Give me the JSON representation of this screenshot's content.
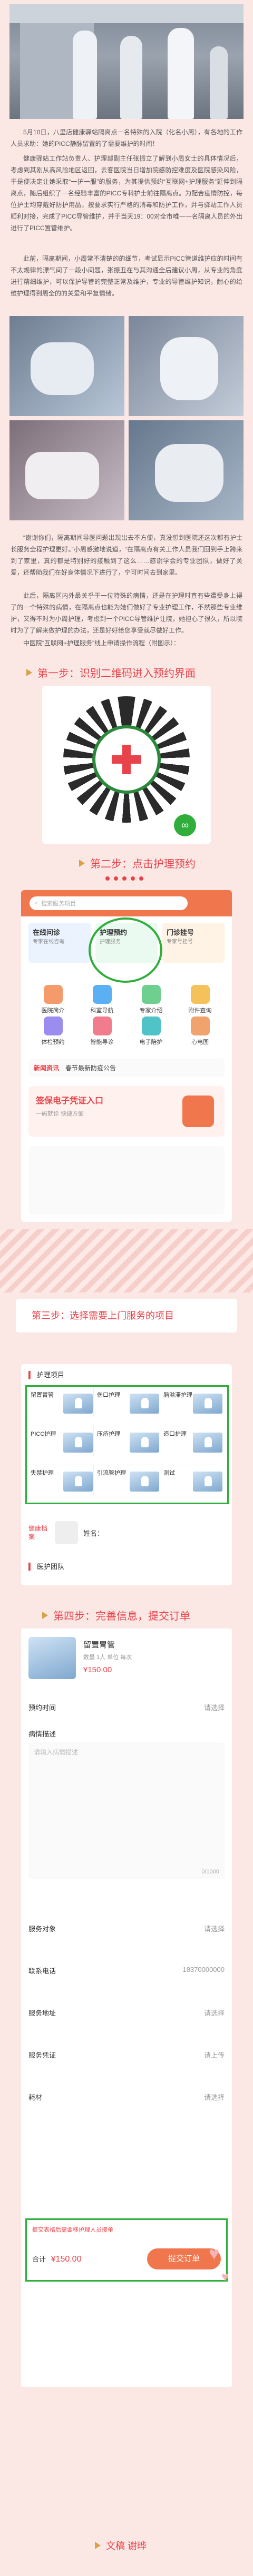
{
  "intro": {
    "p1": "5月10日，八里店健康驿站隔离点一名特殊的入院（化名小周），有各地的工作人员求助：她的PICC静脉留置的了需要维护的时间！",
    "p2": "健康驿站工作站负责人、护理部副主任张振立了解到小周女士的具体情况后，考虑到其刚从高风险地区返回，去客医院当日增加院感防控难度及医院感染风险，于是便决定让她采取“一护一服”的服务，为其提供预约“互联网+护理服务”延伸到隔离点，随后组织了一名经验丰富的PICC专科护士前往隔离点。为配合疫情防控，每位护士均穿戴好防护用品，按要求实行严格的消毒和防护工作，并与驿站工作人员顺利对接，完成了PICC导管维护，并于当天19：00对全市唯一一名隔离人员的外出进行了PICC置管维护。",
    "p3": "此前，隔离期间，小周常不清楚的的细节，考试显示PICC管道维护应的时间有不太规律的漂气间了一段小间题，张振丑在与其沟通全后建议小周，从专业的角度进行精细维护，可以保护导管的完整正常及维护，专业的导管维护知识，耐心的给维护理得到周全的的关爱和平复情绪。",
    "p4": "“谢谢你们，隔离期间导医问题出现出去不方便，真没想到医院还这次都有护士长服务全程护理更好。”小周感激地说道，“在隔离点有关工作人员我们回到手上跨来到了家里，真的都是特别好的接触到了这么……感谢学会的专业团队，做好了关爱，还帮助我们在好身体情况下进行了，宁可时间去到家里。",
    "p5": "此后，隔离区内外最关乎于一位特殊的病情，还是在护理时直有些遭受身上得了的一个特殊的病情，在隔离点也能为她们做好了专业护理工作，不然那些专业维护，又得不时为小周护理，考虑到一个PICC导管维护让院，她担心了很久，所以院时为了了解来做护理的办法，还是好好给您享受就尽做好工作。",
    "p6": "中医院“互联网+护理服务”线上申请操作流程（附图示）："
  },
  "steps": {
    "s1": "第一步：识别二维码进入预约界面",
    "s2": "第二步：点击护理预约",
    "s3": "第三步：选择需要上门服务的项目",
    "s4": "第四步：完善信息，提交订单",
    "author": "文稿 谢晔"
  },
  "phone2": {
    "search_placeholder": "搜索服务项目",
    "cards": [
      {
        "title": "在线问诊",
        "sub": "专家在线咨询"
      },
      {
        "title": "护理预约",
        "sub": "护理服务"
      },
      {
        "title": "门诊挂号",
        "sub": "专家号挂号"
      }
    ],
    "grid": [
      "医院简介",
      "科室导航",
      "专家介绍",
      "附件查询",
      "体检预约",
      "智能导诊",
      "电子陪护",
      "心电图"
    ],
    "news_title": "新闻资讯",
    "news_text": "春节最新防疫公告",
    "banner_title": "签保电子凭证入口",
    "banner_sub": "一码就诊 快捷方便"
  },
  "phone3": {
    "section_title": "护理项目",
    "items": [
      "留置胃管",
      "伤口护理",
      "脑溢滞护理",
      "PICC护理",
      "压疮护理",
      "造口护理",
      "失禁护理",
      "引流管护理",
      "测试"
    ],
    "profile_label": "健康档案",
    "name_label": "姓名：",
    "team_label": "医护团队"
  },
  "phone4": {
    "item_name": "留置胃管",
    "item_sub": "数量 1人   单位 每次",
    "price": "¥150.00",
    "appt_label": "预约时间",
    "appt_value": "请选择",
    "desc_label": "病情描述",
    "desc_placeholder": "请输入病情描述",
    "desc_count": "0/1000",
    "rows": [
      {
        "k": "服务对象",
        "v": "请选择"
      },
      {
        "k": "联系电话",
        "v": "18370000000"
      },
      {
        "k": "服务地址",
        "v": "请选择"
      },
      {
        "k": "服务凭证",
        "v": "请上传"
      },
      {
        "k": "耗材",
        "v": "请选择"
      }
    ],
    "note": "提交表格后需要移护理人员接单",
    "total_label": "合计",
    "total": "¥150.00",
    "submit_label": "提交订单"
  },
  "colors": {
    "accent": "#e8434a",
    "gold": "#d7a24a",
    "bg": "#fbe8e5",
    "green_circle": "#2fae3b"
  }
}
